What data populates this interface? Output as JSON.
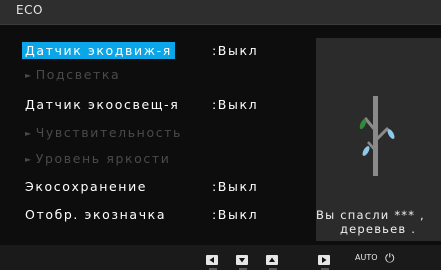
{
  "header": {
    "title": "ECO"
  },
  "menu": {
    "items": [
      {
        "label": "Датчик экодвиж-я",
        "value": ":Выкл",
        "state": "selected"
      },
      {
        "label": "Подсветка",
        "value": "",
        "state": "disabled"
      },
      {
        "label": "Датчик экоосвещ-я",
        "value": ":Выкл",
        "state": "normal"
      },
      {
        "label": "Чувствительность",
        "value": "",
        "state": "disabled"
      },
      {
        "label": "Уровень яркости",
        "value": "",
        "state": "disabled"
      },
      {
        "label": "Экосохранение",
        "value": ":Выкл",
        "state": "normal"
      },
      {
        "label": "Отобр. экозначка",
        "value": ":Выкл",
        "state": "normal"
      }
    ],
    "disabled_arrow": "►"
  },
  "preview": {
    "line1": "Вы спасли *** ,",
    "line2": "деревьев ."
  },
  "footer": {
    "auto_label": "AUTO",
    "power_icon": "⏻"
  },
  "colors": {
    "highlight": "#0aa6e8",
    "disabled_text": "#4a4a4a",
    "leaf_green": "#2e8b3a",
    "leaf_blue": "#8ec9ea"
  }
}
